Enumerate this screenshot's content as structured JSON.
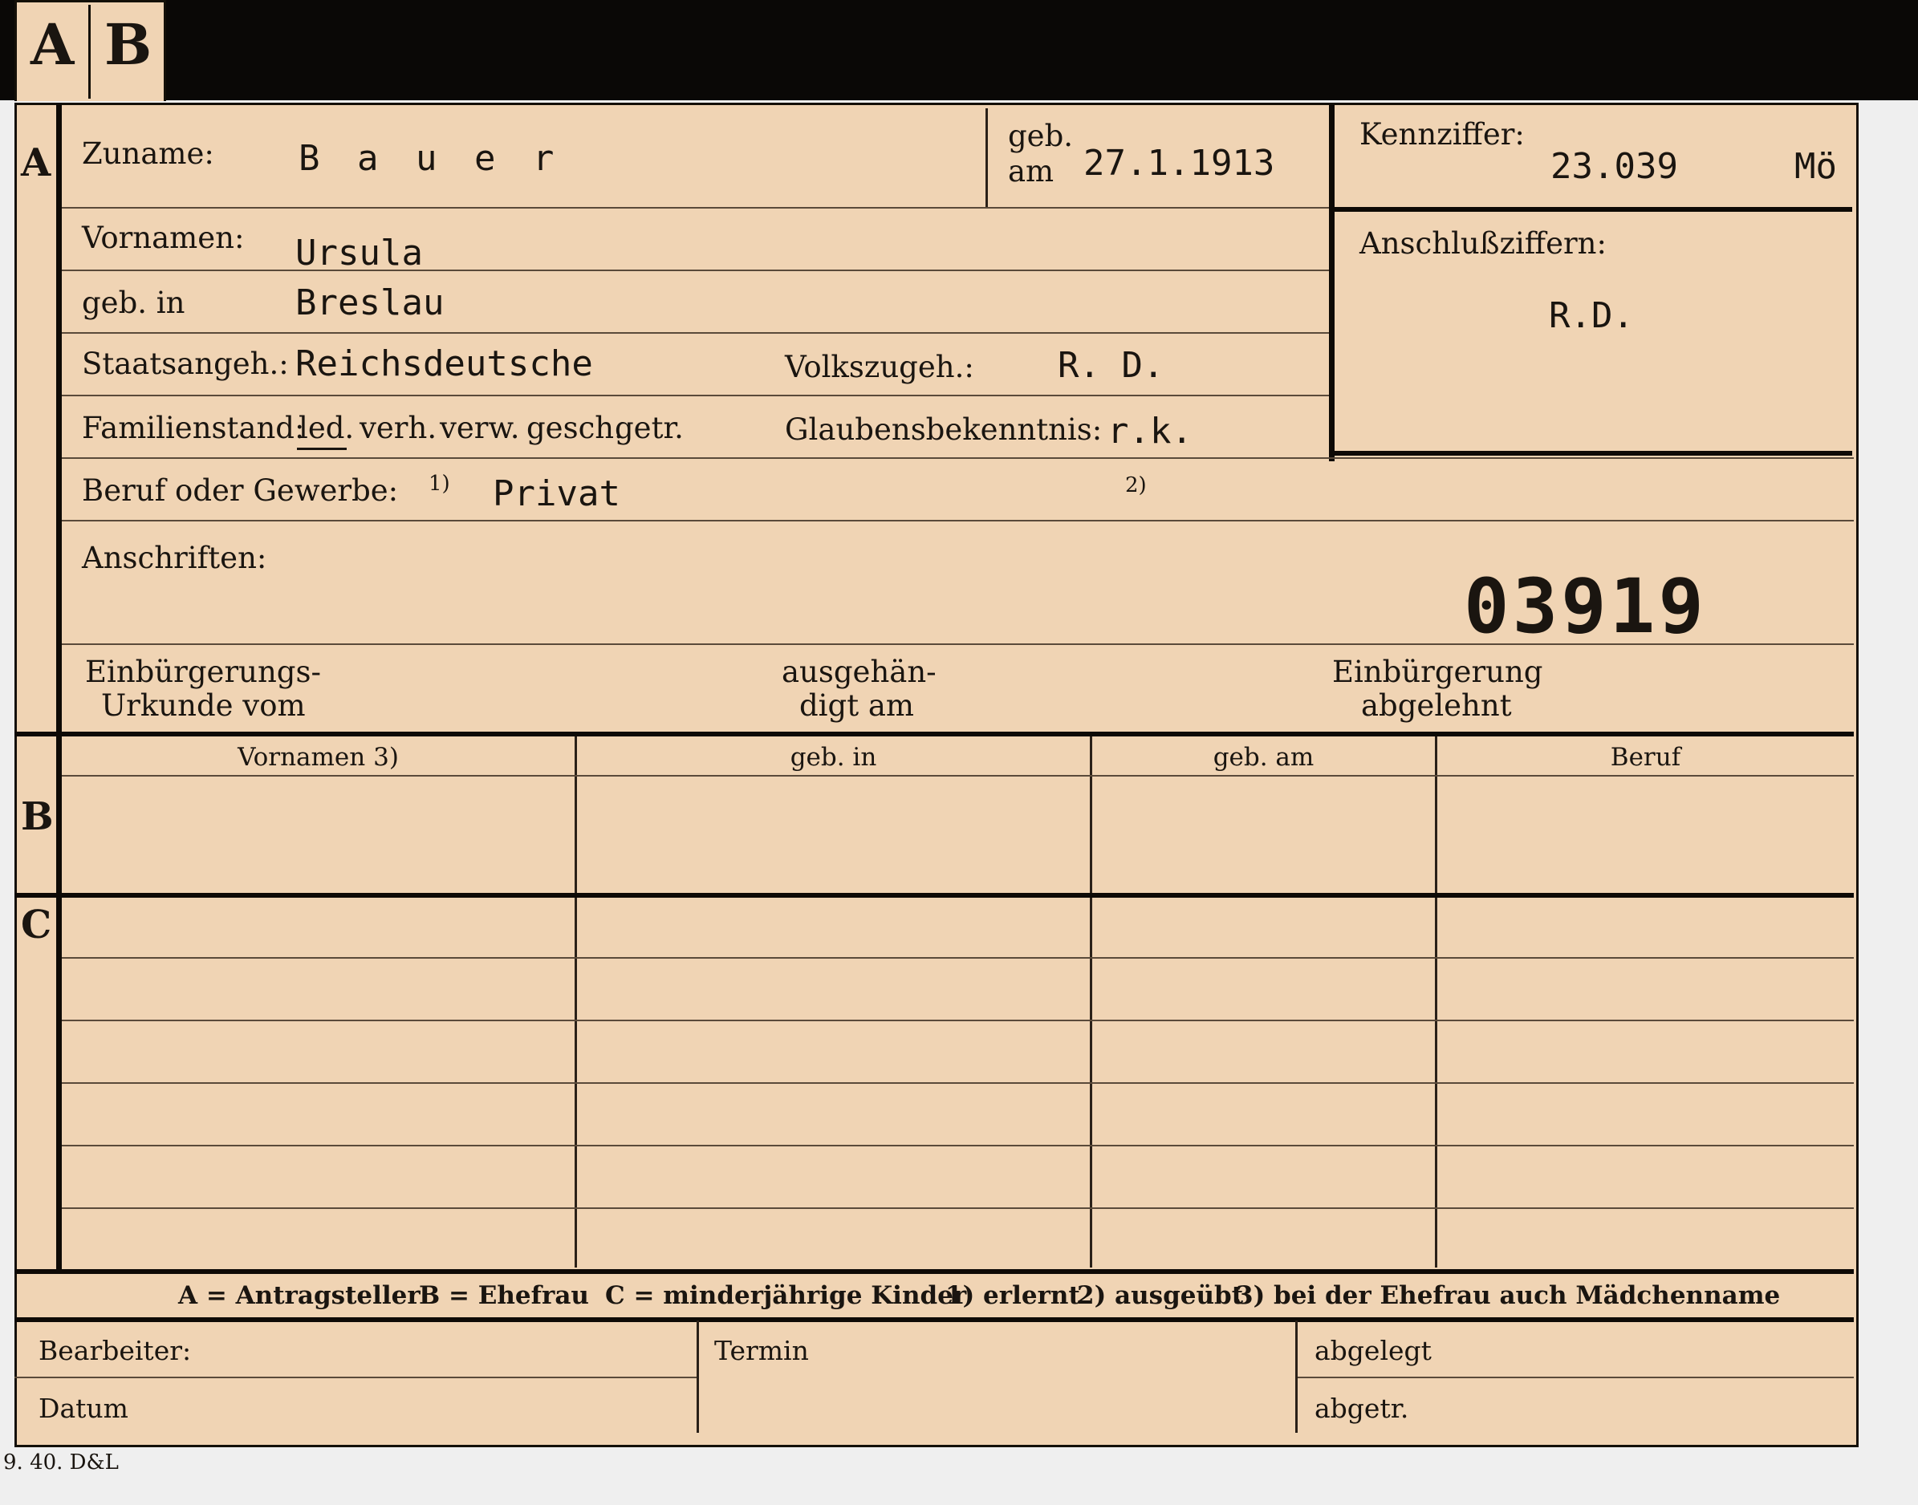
{
  "tabs": {
    "a": "A",
    "b": "B"
  },
  "section_letters": {
    "a": "A",
    "b": "B",
    "c": "C"
  },
  "section_a": {
    "zuname_label": "Zuname:",
    "zuname_value": "B a u e r",
    "geb_label": "geb.",
    "am_label": "am",
    "geb_am_value": "27.1.1913",
    "kennziffer_label": "Kennziffer:",
    "kennziffer_value": "23.039",
    "kennziffer_suffix": "Mö",
    "vornamen_label": "Vornamen:",
    "vornamen_value": "Ursula",
    "geb_in_label": "geb. in",
    "geb_in_value": "Breslau",
    "anschluss_label": "Anschlußziffern:",
    "anschluss_value": "R.D.",
    "staatsangeh_label": "Staatsangeh.:",
    "staatsangeh_value": "Reichsdeutsche",
    "volkszugeh_label": "Volkszugeh.:",
    "volkszugeh_value": "R. D.",
    "familienstand_label": "Familienstand:",
    "familienstand_options": [
      "led.",
      "verh.",
      "verw.",
      "gesch.",
      "getr."
    ],
    "familienstand_selected": "led.",
    "glaubens_label": "Glaubensbekenntnis:",
    "glaubens_value": "r.k.",
    "beruf_label": "Beruf oder Gewerbe:",
    "beruf_note1": "1)",
    "beruf_value": "Privat",
    "beruf_note2": "2)",
    "anschriften_label": "Anschriften:",
    "stamp_number": "03919",
    "einbuergerung_urkunde_line1": "Einbürgerungs-",
    "einbuergerung_urkunde_line2": "Urkunde vom",
    "ausgehaendigt_line1": "ausgehän-",
    "ausgehaendigt_line2": "digt am",
    "abgelehnt_line1": "Einbürgerung",
    "abgelehnt_line2": "abgelehnt"
  },
  "table": {
    "headers": [
      "Vornamen 3)",
      "geb. in",
      "geb. am",
      "Beruf"
    ]
  },
  "legend": {
    "a": "A = Antragsteller",
    "b": "B = Ehefrau",
    "c": "C = minderjährige Kinder",
    "n1": "1) erlernt",
    "n2": "2) ausgeübt",
    "n3": "3) bei der Ehefrau auch Mädchenname"
  },
  "footer": {
    "bearbeiter": "Bearbeiter:",
    "datum": "Datum",
    "termin": "Termin",
    "abgelegt": "abgelegt",
    "abgetr": "abgetr."
  },
  "print_mark": "9. 40. D&L"
}
